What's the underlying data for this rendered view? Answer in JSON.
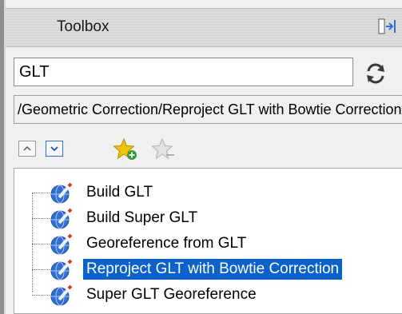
{
  "panel": {
    "title": "Toolbox"
  },
  "search": {
    "value": "GLT"
  },
  "path": {
    "text": "/Geometric Correction/Reproject GLT with Bowtie Correction"
  },
  "tree": {
    "items": [
      {
        "label": "Build GLT",
        "selected": false
      },
      {
        "label": "Build Super GLT",
        "selected": false
      },
      {
        "label": "Georeference from GLT",
        "selected": false
      },
      {
        "label": "Reproject GLT with Bowtie Correction",
        "selected": true
      },
      {
        "label": "Super GLT Georeference",
        "selected": false
      }
    ]
  },
  "colors": {
    "selection": "#0a62cc",
    "star_active": "#f5c400",
    "star_inactive": "#d0d0d0"
  }
}
